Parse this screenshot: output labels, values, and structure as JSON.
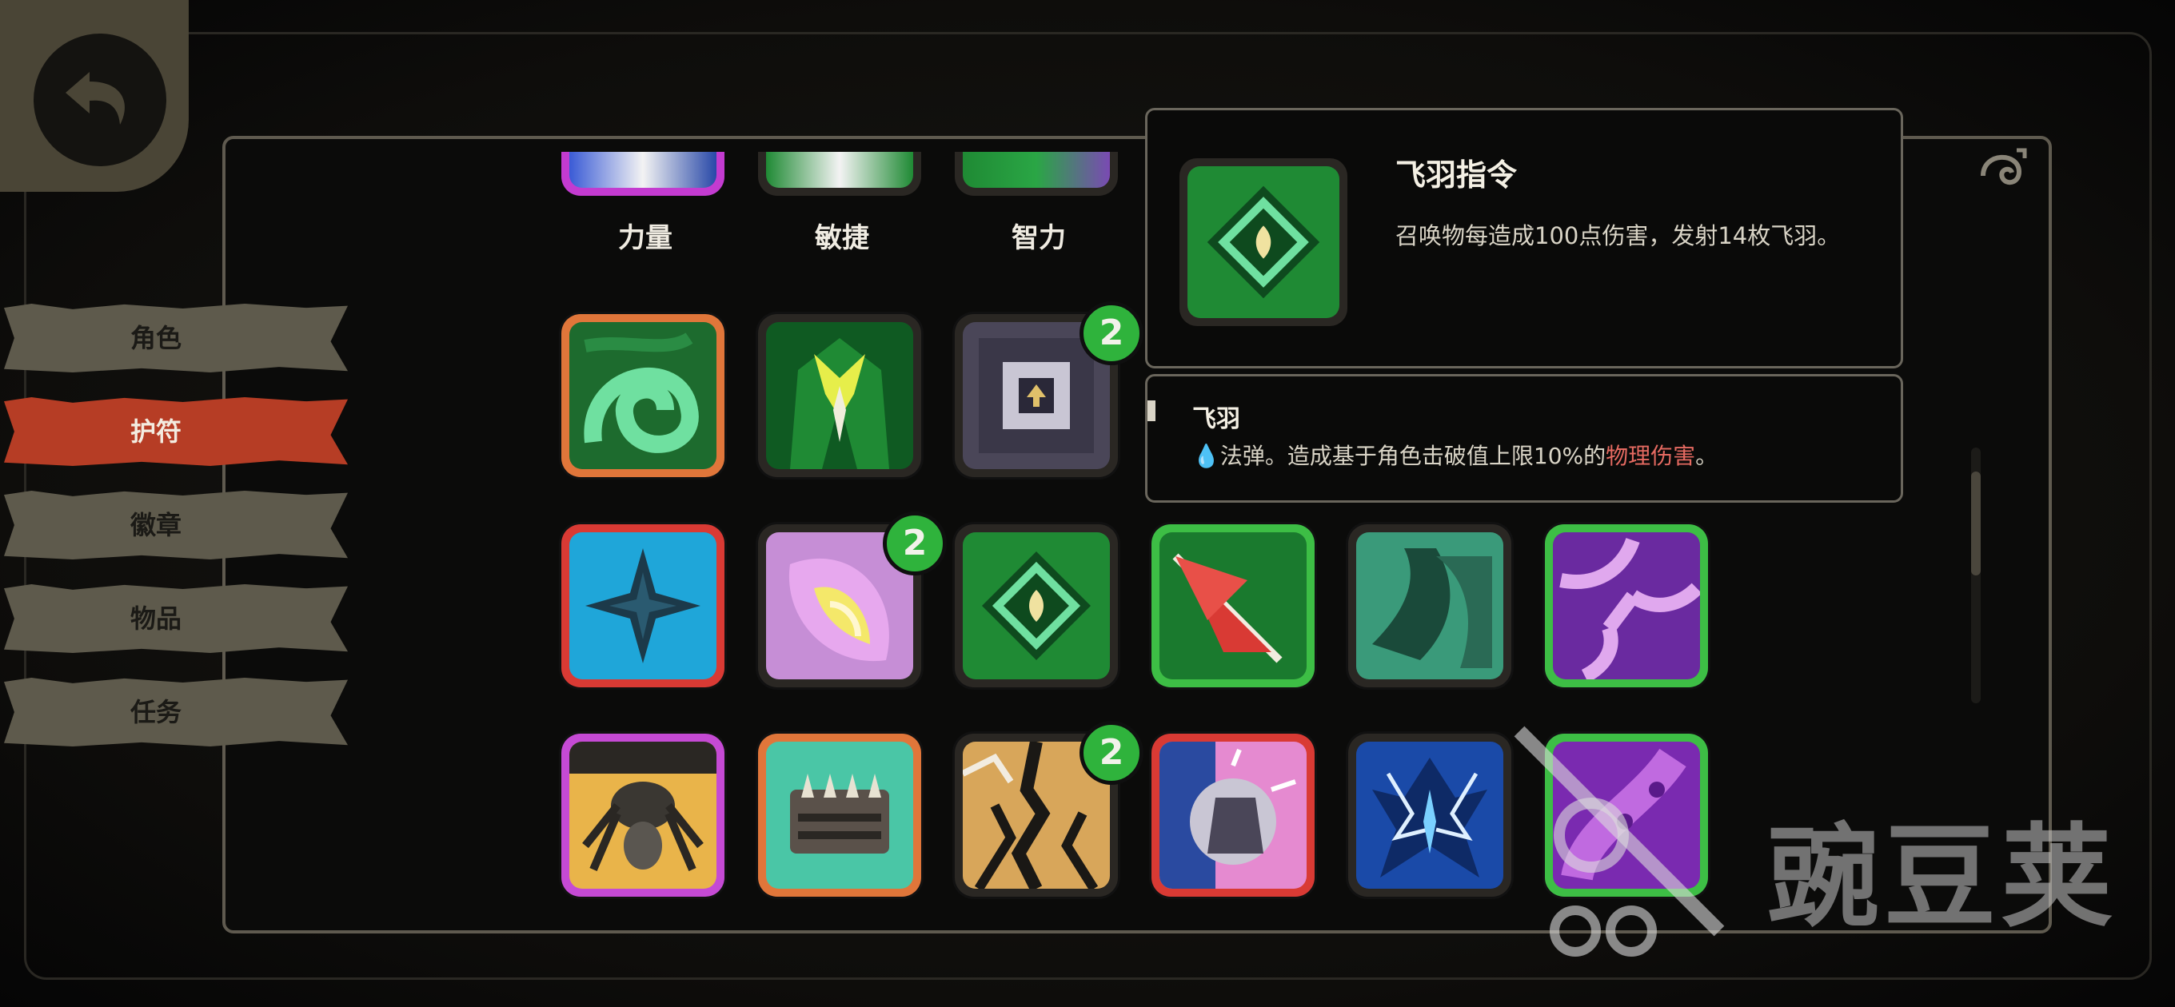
{
  "sidebar": {
    "items": [
      {
        "label": "角色",
        "active": false
      },
      {
        "label": "护符",
        "active": true
      },
      {
        "label": "徽章",
        "active": false
      },
      {
        "label": "物品",
        "active": false
      },
      {
        "label": "任务",
        "active": false
      }
    ]
  },
  "stats": {
    "strength": "力量",
    "agility": "敏捷",
    "intellect": "智力"
  },
  "grid": {
    "row1": [
      {
        "icon": "green-swirl-icon",
        "border": "#e0763a"
      },
      {
        "icon": "green-cloak-icon",
        "border": "#3a3732"
      },
      {
        "icon": "gray-portal-icon",
        "border": "#3a3732",
        "badge": "2"
      }
    ],
    "row2": [
      {
        "icon": "blue-star-icon",
        "border": "#d93a34"
      },
      {
        "icon": "pink-leaf-icon",
        "border": "#3a3732",
        "badge": "2"
      },
      {
        "icon": "green-diamond-icon",
        "border": "#3a3732"
      },
      {
        "icon": "red-arrow-icon",
        "border": "#3dbe45"
      },
      {
        "icon": "teal-claw-icon",
        "border": "#3a3732"
      },
      {
        "icon": "purple-web-icon",
        "border": "#3dbe45"
      }
    ],
    "row3": [
      {
        "icon": "spider-icon",
        "border": "#c54ad4"
      },
      {
        "icon": "ammo-belt-icon",
        "border": "#e0763a"
      },
      {
        "icon": "cracked-ground-icon",
        "border": "#3a3732",
        "badge": "2"
      },
      {
        "icon": "fist-icon",
        "border": "#d93a34"
      },
      {
        "icon": "lightning-bird-icon",
        "border": "#3a3732"
      },
      {
        "icon": "purple-tentacle-icon",
        "border": "#3dbe45"
      }
    ]
  },
  "tooltip": {
    "title": "飞羽指令",
    "description": "召唤物每造成100点伤害，发射14枚飞羽。",
    "sub_title": "飞羽",
    "sub_desc_prefix": "法弹。造成基于角色击破值上限10%的",
    "sub_desc_highlight": "物理伤害",
    "sub_desc_suffix": "。"
  },
  "watermark": {
    "text": "豌豆荚"
  }
}
